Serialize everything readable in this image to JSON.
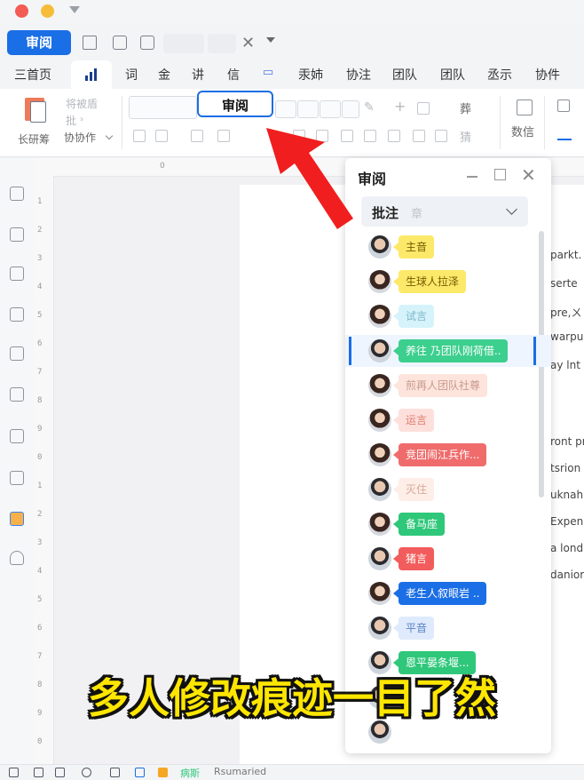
{
  "toolbar": {
    "primary_button": "审阅"
  },
  "menu": [
    "三首页",
    "词",
    "金",
    "讲",
    "信",
    "汞姉",
    "协注",
    "团队",
    "团队",
    "丞示",
    "协件"
  ],
  "ribbon": {
    "left_big_label": "长研筹",
    "faint_top": "将被盾",
    "faint_mid": "批 ᵌ",
    "collab_label": "协协作",
    "highlight": "审阅",
    "right_item_1": "葬",
    "right_item_2": "猜",
    "data_label": "数信"
  },
  "ruler": {
    "h_mark": "0",
    "v_marks": [
      "1",
      "2",
      "3",
      "4",
      "5",
      "6",
      "7",
      "8",
      "9",
      "0",
      "1",
      "2",
      "3",
      "4",
      "5",
      "6",
      "7",
      "8",
      "9",
      "0"
    ]
  },
  "doc_lines": [
    "parkt.",
    "serte",
    "pre,ㄨ",
    "warpu",
    "ay lnt",
    "ront pr",
    "tsrion",
    "uknah",
    "Expen",
    "a lond",
    "danior"
  ],
  "panel": {
    "title": "审阅",
    "dropdown_label": "批注",
    "dropdown_faint": "章",
    "comments": [
      {
        "text": "主音",
        "gender": "m",
        "bg": "#fce96a",
        "fg": "#7a5a00"
      },
      {
        "text": "生球人拉泽",
        "gender": "f",
        "bg": "#fce96a",
        "fg": "#7a5a00"
      },
      {
        "text": "试言",
        "gender": "f",
        "bg": "#d6f3fb",
        "fg": "#7ab6c8"
      },
      {
        "text": "养往 乃团队刚荷借..",
        "gender": "m",
        "bg": "#3ccf8e",
        "fg": "#ffffff"
      },
      {
        "text": "煎再人团队社尊",
        "gender": "f",
        "bg": "#fde4dc",
        "fg": "#c99a8d"
      },
      {
        "text": "运言",
        "gender": "f",
        "bg": "#fde0dc",
        "fg": "#e07a6d"
      },
      {
        "text": "竞团闹江兵作...",
        "gender": "f",
        "bg": "#f06c6c",
        "fg": "#ffffff"
      },
      {
        "text": "灭住",
        "gender": "m",
        "bg": "#fdeee8",
        "fg": "#d9a999"
      },
      {
        "text": "备马座",
        "gender": "f",
        "bg": "#2fc77a",
        "fg": "#ffffff"
      },
      {
        "text": "猪言",
        "gender": "m",
        "bg": "#f25c5c",
        "fg": "#ffffff"
      },
      {
        "text": "老生人叙眼岩 ..",
        "gender": "f",
        "bg": "#1a6ee6",
        "fg": "#ffffff"
      },
      {
        "text": "平音",
        "gender": "m",
        "bg": "#dfeafc",
        "fg": "#5b84c6"
      },
      {
        "text": "恩平晏条堰...",
        "gender": "m",
        "bg": "#2fc77a",
        "fg": "#ffffff"
      },
      {
        "text": "",
        "gender": "m",
        "bg": "#ffffff",
        "fg": "#ffffff"
      },
      {
        "text": "",
        "gender": "m",
        "bg": "#ffffff",
        "fg": "#ffffff"
      }
    ]
  },
  "caption": "多人修改痕迹一目了然",
  "status": {
    "label_green": "病斯",
    "label_text": "Rsumaried"
  }
}
